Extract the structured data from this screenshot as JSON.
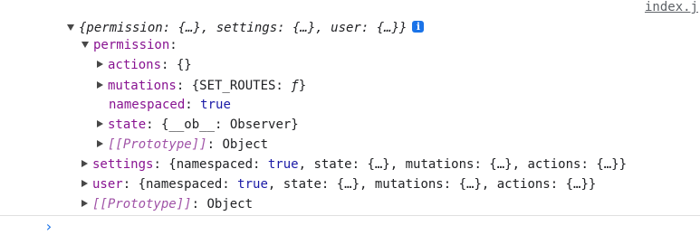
{
  "source_link": "index.j",
  "root": {
    "summary": "{permission: {…}, settings: {…}, user: {…}}",
    "info_icon": "i"
  },
  "permission": {
    "key": "permission",
    "actions": {
      "key": "actions",
      "value": "{}"
    },
    "mutations": {
      "key": "mutations",
      "value": "{SET_ROUTES: ",
      "fn": "ƒ",
      "close": "}"
    },
    "namespaced": {
      "key": "namespaced",
      "value": "true"
    },
    "state": {
      "key": "state",
      "value": "{__ob__: Observer}"
    },
    "prototype": {
      "key": "[[Prototype]]",
      "value": "Object"
    }
  },
  "settings": {
    "key": "settings",
    "value_pre": "{namespaced: ",
    "value_true": "true",
    "value_post": ", state: {…}, mutations: {…}, actions: {…}}"
  },
  "user": {
    "key": "user",
    "value_pre": "{namespaced: ",
    "value_true": "true",
    "value_post": ", state: {…}, mutations: {…}, actions: {…}}"
  },
  "root_prototype": {
    "key": "[[Prototype]]",
    "value": "Object"
  },
  "prompt": "›",
  "colors": {
    "key": "#881391",
    "keyword": "#1a1aa6",
    "accent": "#1a73e8"
  }
}
